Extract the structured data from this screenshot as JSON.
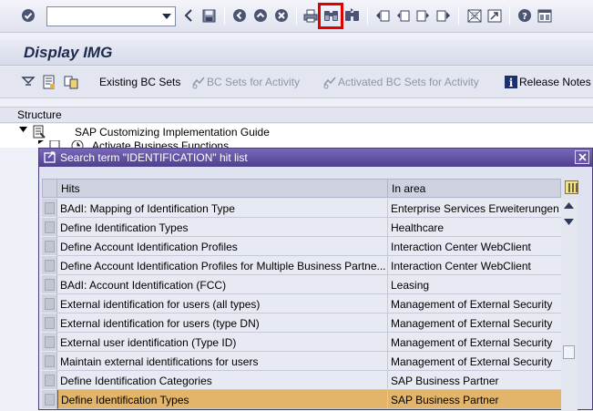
{
  "system_toolbar": {
    "command_field": {
      "value": "",
      "placeholder": ""
    },
    "icons": [
      "enter-icon",
      "back-icon",
      "save-icon",
      "exit-icon",
      "cancel-icon",
      "print-icon",
      "find-icon",
      "find-next-icon",
      "first-page-icon",
      "previous-page-icon",
      "next-page-icon",
      "last-page-icon",
      "new-session-icon",
      "shortcut-icon",
      "help-icon",
      "layout-menu-icon"
    ],
    "highlighted_icon": "find-icon",
    "highlight_color": "#e00000"
  },
  "title_bar": {
    "title": "Display IMG"
  },
  "app_toolbar": {
    "buttons": [
      {
        "label": "Existing BC Sets",
        "enabled": true
      },
      {
        "label": "BC Sets for Activity",
        "enabled": false
      },
      {
        "label": "Activated BC Sets for Activity",
        "enabled": false
      },
      {
        "label": "Release Notes",
        "enabled": true
      }
    ]
  },
  "structure": {
    "header": "Structure",
    "tree": [
      {
        "label": "SAP Customizing Implementation Guide",
        "expanded": true
      },
      {
        "label": "Activate Business Functions",
        "expanded": false
      }
    ]
  },
  "dialog": {
    "title": "Search term \"IDENTIFICATION\" hit list",
    "columns": {
      "hits": "Hits",
      "area": "In area"
    },
    "rows": [
      {
        "hits": "BAdI: Mapping of Identification Type",
        "area": "Enterprise Services Erweiterungen"
      },
      {
        "hits": "Define Identification Types",
        "area": "Healthcare"
      },
      {
        "hits": "Define Account Identification Profiles",
        "area": "Interaction Center WebClient"
      },
      {
        "hits": "Define Account Identification Profiles for Multiple Business Partne...",
        "area": "Interaction Center WebClient"
      },
      {
        "hits": "BAdI: Account Identification (FCC)",
        "area": "Leasing"
      },
      {
        "hits": "External identification for users (all types)",
        "area": "Management of External Security"
      },
      {
        "hits": "External identification for users (type DN)",
        "area": "Management of External Security"
      },
      {
        "hits": "External user identification (Type ID)",
        "area": "Management of External Security"
      },
      {
        "hits": "Maintain external identifications for users",
        "area": "Management of External Security"
      },
      {
        "hits": "Define Identification Categories",
        "area": "SAP Business Partner"
      },
      {
        "hits": "Define Identification Types",
        "area": "SAP Business Partner",
        "selected": true
      }
    ],
    "selected_row_color": "#e2b56a"
  }
}
